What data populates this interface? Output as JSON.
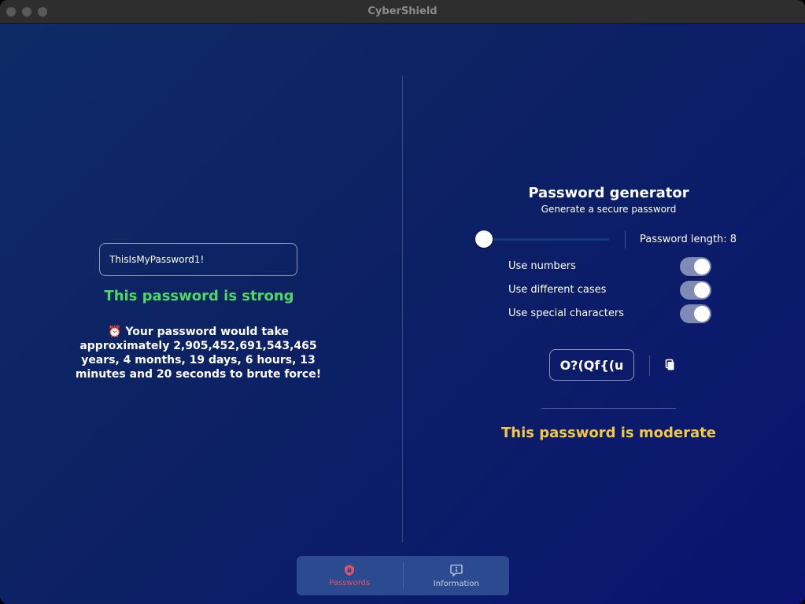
{
  "window": {
    "title": "CyberShield"
  },
  "checker": {
    "password_value": "ThisIsMyPassword1!",
    "strength_text": "This password is strong",
    "strength_color": "#4cd964",
    "bruteforce_text": "⏰ Your password would take approximately 2,905,452,691,543,465 years, 4 months, 19 days, 6 hours, 13 minutes and 20 seconds to brute force!"
  },
  "generator": {
    "title": "Password generator",
    "subtitle": "Generate a secure password",
    "length_label": "Password length: 8",
    "length_value": 8,
    "options": [
      {
        "label": "Use numbers",
        "enabled": true
      },
      {
        "label": "Use different cases",
        "enabled": true
      },
      {
        "label": "Use special characters",
        "enabled": true
      }
    ],
    "generated_password": "O?(Qf{(u",
    "copy_icon": "copy-icon",
    "strength_text": "This password is moderate",
    "strength_color": "#f5c842"
  },
  "nav": {
    "items": [
      {
        "label": "Passwords",
        "icon": "lock-shield-icon",
        "active": true,
        "color": "#e05563"
      },
      {
        "label": "Information",
        "icon": "info-bubble-icon",
        "active": false,
        "color": "#c9d1e6"
      }
    ]
  }
}
